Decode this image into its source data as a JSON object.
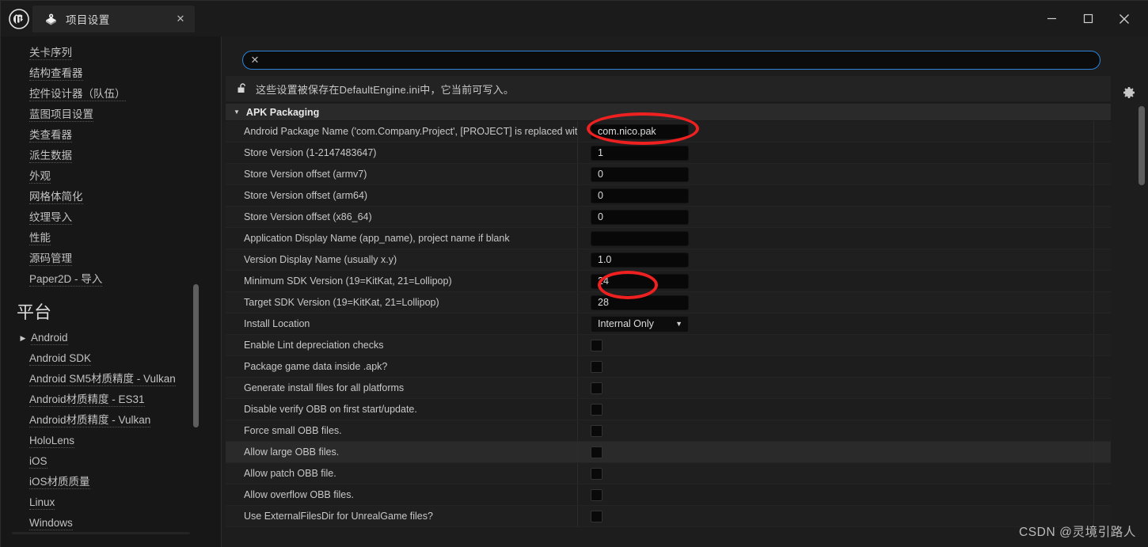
{
  "window": {
    "tab_title": "项目设置",
    "tab_icon": "project-settings-icon",
    "close_label": "✕",
    "minimize_label": "–",
    "maximize_label": "□",
    "window_close_label": "✕"
  },
  "sidebar": {
    "items": [
      {
        "label": "关卡序列",
        "arrow": false
      },
      {
        "label": "结构查看器",
        "arrow": false
      },
      {
        "label": "控件设计器（队伍）",
        "arrow": false
      },
      {
        "label": "蓝图项目设置",
        "arrow": false
      },
      {
        "label": "类查看器",
        "arrow": false
      },
      {
        "label": "派生数据",
        "arrow": false
      },
      {
        "label": "外观",
        "arrow": false
      },
      {
        "label": "网格体简化",
        "arrow": false
      },
      {
        "label": "纹理导入",
        "arrow": false
      },
      {
        "label": "性能",
        "arrow": false
      },
      {
        "label": "源码管理",
        "arrow": false
      },
      {
        "label": "Paper2D - 导入",
        "arrow": false
      }
    ],
    "section_title": "平台",
    "platform_items": [
      {
        "label": "Android",
        "arrow": true
      },
      {
        "label": "Android SDK",
        "arrow": false
      },
      {
        "label": "Android SM5材质精度 - Vulkan",
        "arrow": false
      },
      {
        "label": "Android材质精度 - ES31",
        "arrow": false
      },
      {
        "label": "Android材质精度 - Vulkan",
        "arrow": false
      },
      {
        "label": "HoloLens",
        "arrow": false
      },
      {
        "label": "iOS",
        "arrow": false
      },
      {
        "label": "iOS材质质量",
        "arrow": false
      },
      {
        "label": "Linux",
        "arrow": false
      },
      {
        "label": "Windows",
        "arrow": false
      }
    ]
  },
  "search": {
    "value": "",
    "placeholder": "",
    "clear_label": "✕",
    "settings_icon": "gear-icon"
  },
  "info": {
    "icon": "unlocked-padlock-icon",
    "text": "这些设置被保存在DefaultEngine.ini中，它当前可写入。"
  },
  "group": {
    "title": "APK Packaging",
    "expanded_marker": "▼"
  },
  "rows": [
    {
      "name": "Android Package Name ('com.Company.Project', [PROJECT] is replaced with proje...",
      "type": "text",
      "value": "com.nico.pak"
    },
    {
      "name": "Store Version (1-2147483647)",
      "type": "text",
      "value": "1"
    },
    {
      "name": "Store Version offset (armv7)",
      "type": "text",
      "value": "0"
    },
    {
      "name": "Store Version offset (arm64)",
      "type": "text",
      "value": "0"
    },
    {
      "name": "Store Version offset (x86_64)",
      "type": "text",
      "value": "0"
    },
    {
      "name": "Application Display Name (app_name), project name if blank",
      "type": "text",
      "value": ""
    },
    {
      "name": "Version Display Name (usually x.y)",
      "type": "text",
      "value": "1.0"
    },
    {
      "name": "Minimum SDK Version (19=KitKat, 21=Lollipop)",
      "type": "text",
      "value": "24"
    },
    {
      "name": "Target SDK Version (19=KitKat, 21=Lollipop)",
      "type": "text",
      "value": "28"
    },
    {
      "name": "Install Location",
      "type": "combo",
      "value": "Internal Only",
      "chevron": "⌄"
    },
    {
      "name": "Enable Lint depreciation checks",
      "type": "checkbox",
      "value": ""
    },
    {
      "name": "Package game data inside .apk?",
      "type": "checkbox",
      "value": ""
    },
    {
      "name": "Generate install files for all platforms",
      "type": "checkbox",
      "value": ""
    },
    {
      "name": "Disable verify OBB on first start/update.",
      "type": "checkbox",
      "value": ""
    },
    {
      "name": "Force small OBB files.",
      "type": "checkbox",
      "value": ""
    },
    {
      "name": "Allow large OBB files.",
      "type": "checkbox",
      "value": "",
      "hover": true
    },
    {
      "name": "Allow patch OBB file.",
      "type": "checkbox",
      "value": ""
    },
    {
      "name": "Allow overflow OBB files.",
      "type": "checkbox",
      "value": ""
    },
    {
      "name": "Use ExternalFilesDir for UnrealGame files?",
      "type": "checkbox",
      "value": ""
    }
  ],
  "annotations": {
    "color": "#ef2020",
    "items": [
      {
        "id": "annot-pkg",
        "target": "Android Package Name value"
      },
      {
        "id": "annot-sdk",
        "target": "Minimum SDK Version value"
      }
    ]
  },
  "watermark": "CSDN @灵境引路人"
}
